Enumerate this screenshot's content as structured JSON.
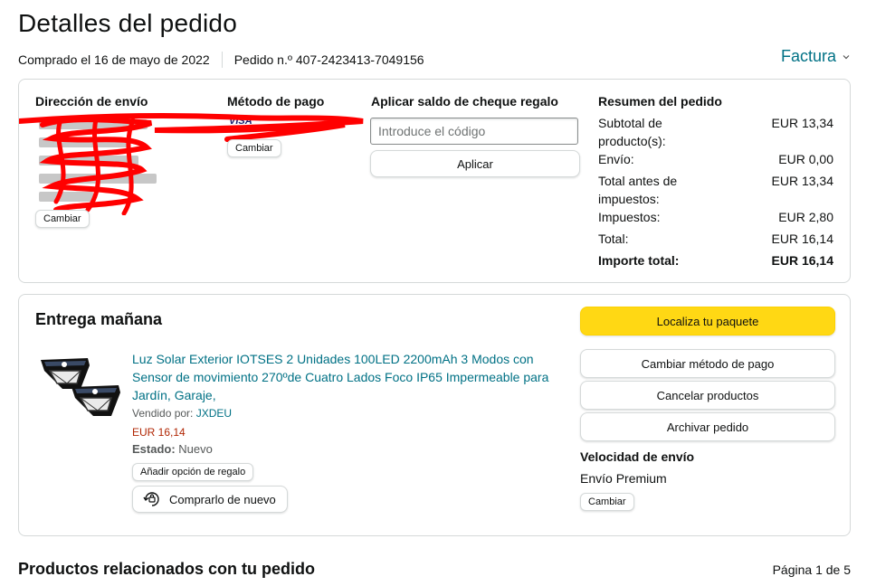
{
  "page": {
    "title": "Detalles del pedido"
  },
  "order": {
    "purchased": "Comprado el 16 de mayo de 2022",
    "number": "Pedido n.º 407-2423413-7049156",
    "invoice_label": "Factura"
  },
  "shipping": {
    "heading": "Dirección de envío",
    "change": "Cambiar"
  },
  "payment": {
    "heading": "Método de pago",
    "change": "Cambiar",
    "card_brand": "VISA"
  },
  "gift": {
    "heading": "Aplicar saldo de cheque regalo",
    "placeholder": "Introduce el código",
    "apply": "Aplicar"
  },
  "summary": {
    "heading": "Resumen del pedido",
    "rows": [
      {
        "label": "Subtotal de producto(s):",
        "value": "EUR 13,34"
      },
      {
        "label": "Envío:",
        "value": "EUR 0,00"
      },
      {
        "label": "Total antes de impuestos:",
        "value": "EUR 13,34"
      },
      {
        "label": "Impuestos:",
        "value": "EUR 2,80"
      },
      {
        "label": "Total:",
        "value": "EUR 16,14"
      }
    ],
    "total_label": "Importe total:",
    "total_value": "EUR 16,14"
  },
  "delivery": {
    "heading": "Entrega mañana",
    "product": {
      "title": "Luz Solar Exterior IOTSES 2 Unidades 100LED 2200mAh 3 Modos con Sensor de movimiento 270ºde Cuatro Lados Foco IP65 Impermeable para Jardín, Garaje,",
      "sold_by_label": "Vendido por:",
      "seller": "JXDEU",
      "price": "EUR 16,14",
      "state_label": "Estado:",
      "state_value": "Nuevo",
      "gift_option": "Añadir opción de regalo",
      "buy_again": "Comprarlo de nuevo"
    },
    "actions": {
      "track": "Localiza tu paquete",
      "change_payment": "Cambiar método de pago",
      "cancel": "Cancelar productos",
      "archive": "Archivar pedido"
    },
    "speed": {
      "heading": "Velocidad de envío",
      "value": "Envío Premium",
      "change": "Cambiar"
    }
  },
  "related": {
    "heading": "Productos relacionados con tu pedido",
    "page": "Página 1 de 5"
  },
  "colors": {
    "link": "#007185",
    "price": "#b12704",
    "primary_button": "#ffd814",
    "redaction": "#ff0000"
  }
}
